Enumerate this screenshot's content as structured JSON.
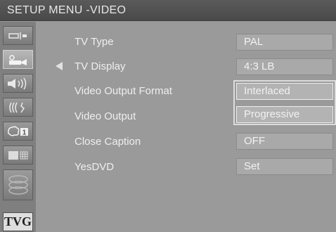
{
  "title": "SETUP MENU -VIDEO",
  "sidebar": {
    "items": [
      {
        "icon": "general-settings-icon",
        "active": false
      },
      {
        "icon": "video-camera-icon",
        "active": true
      },
      {
        "icon": "speaker-audio-icon",
        "active": false
      },
      {
        "icon": "dolby-sound-icon",
        "active": false
      },
      {
        "icon": "language-icon",
        "badge": "1",
        "active": false
      },
      {
        "icon": "display-grid-icon",
        "active": false
      },
      {
        "icon": "disc-stack-icon",
        "active": false
      }
    ],
    "tvg_label": "TVG"
  },
  "rows": [
    {
      "label": "TV Type",
      "value": "PAL"
    },
    {
      "label": "TV Display",
      "value": "4:3 LB"
    },
    {
      "label": "Video Output Format",
      "value": "Interlaced"
    },
    {
      "label": "Video Output",
      "value": "Progressive"
    },
    {
      "label": "Close Caption",
      "value": "OFF"
    },
    {
      "label": "YesDVD",
      "value": "Set"
    }
  ]
}
